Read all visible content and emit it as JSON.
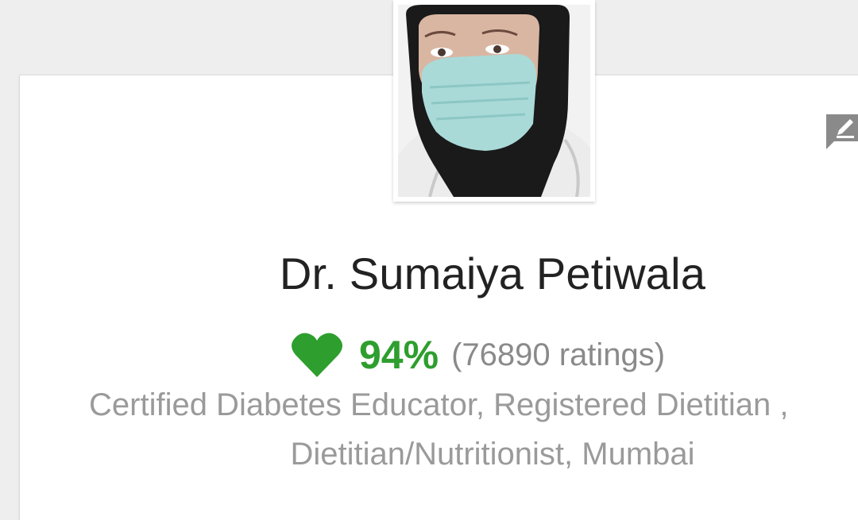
{
  "profile": {
    "name": "Dr. Sumaiya Petiwala",
    "rating_percent": "94%",
    "rating_count": "(76890 ratings)",
    "specialty_line1": "Certified Diabetes Educator, Registered Dietitian ,",
    "specialty_line2": "Dietitian/Nutritionist, Mumbai",
    "photo_icon": "doctor-profile-photo",
    "heart_icon": "heart-icon",
    "feedback_icon": "feedback-edit-icon"
  },
  "colors": {
    "background": "#eeeeee",
    "card": "#ffffff",
    "name": "#222222",
    "rating_green": "#2e9e2e",
    "secondary_text": "#9a9a9a",
    "icon_gray": "#8a8a8a"
  }
}
